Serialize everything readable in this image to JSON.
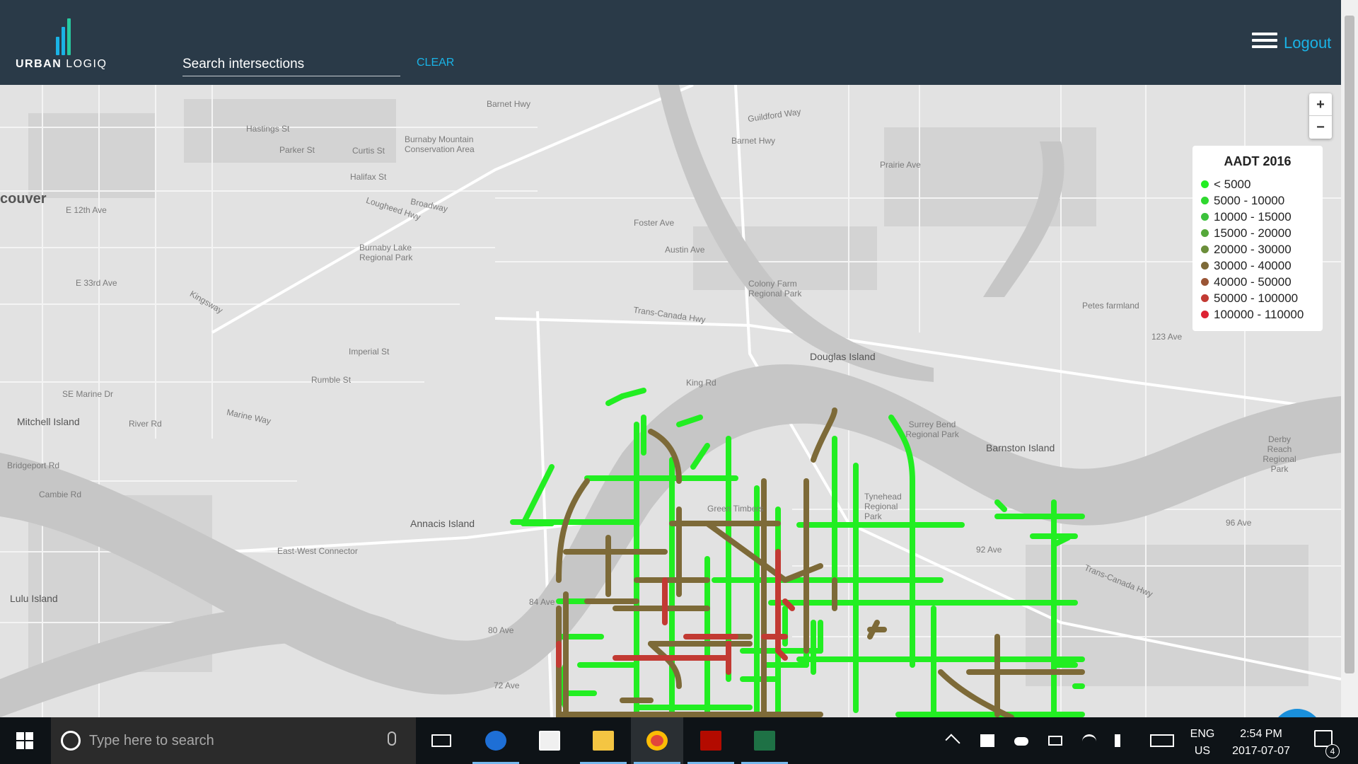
{
  "header": {
    "brand_bold": "URBAN",
    "brand_light": " LOGIQ",
    "search_placeholder": "Search intersections",
    "clear_label": "CLEAR",
    "logout_label": "Logout"
  },
  "map": {
    "zoom_in": "+",
    "zoom_out": "−",
    "labels": [
      "Barnet Hwy",
      "Hastings St",
      "Parker St",
      "Curtis St",
      "Burnaby Mountain Conservation Area",
      "Halifax St",
      "couver",
      "E 12th Ave",
      "Burnaby Lake Regional Park",
      "Lougheed Hwy",
      "Broadway",
      "E 33rd Ave",
      "Kingsway",
      "Imperial St",
      "Rumble St",
      "SE Marine Dr",
      "Mitchell Island",
      "Marine Way",
      "River Rd",
      "Bridgeport Rd",
      "Cambie Rd",
      "Annacis Island",
      "East-West Connector",
      "Lulu Island",
      "Guildford Way",
      "Barnet Hwy",
      "Prairie Ave",
      "Foster Ave",
      "Austin Ave",
      "Colony Farm Regional Park",
      "Trans-Canada Hwy",
      "Douglas Island",
      "King Rd",
      "Surrey Bend Regional Park",
      "Barnston Island",
      "Tynehead Regional Park",
      "Green Timbers",
      "Petes farmland",
      "123 Ave",
      "Derby Reach Regional Park",
      "96 Ave",
      "92 Ave",
      "84 Ave",
      "80 Ave",
      "72 Ave",
      "Trans-Canada Hwy"
    ]
  },
  "legend": {
    "title": "AADT 2016",
    "items": [
      {
        "label": "< 5000",
        "color": "#22ee22"
      },
      {
        "label": "5000 - 10000",
        "color": "#2fd82f"
      },
      {
        "label": "10000 - 15000",
        "color": "#3cc23c"
      },
      {
        "label": "15000 - 20000",
        "color": "#55a83a"
      },
      {
        "label": "20000 - 30000",
        "color": "#6b8e3a"
      },
      {
        "label": "30000 - 40000",
        "color": "#7d6a38"
      },
      {
        "label": "40000 - 50000",
        "color": "#9a5535"
      },
      {
        "label": "50000 - 100000",
        "color": "#c23a33"
      },
      {
        "label": "100000 - 110000",
        "color": "#dd2233"
      }
    ]
  },
  "taskbar": {
    "search_text": "Type here to search",
    "ime_lang": "ENG",
    "ime_region": "US",
    "time": "2:54 PM",
    "date": "2017-07-07",
    "notification_count": "4"
  }
}
